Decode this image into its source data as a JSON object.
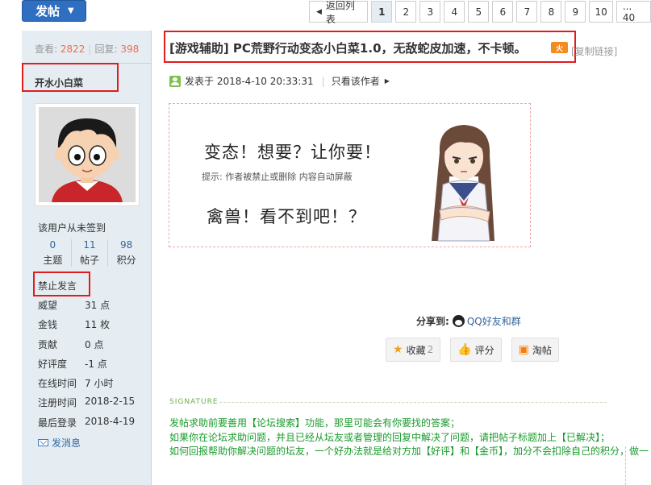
{
  "toolbar": {
    "post_button": "发帖",
    "post_caret": "▼"
  },
  "pager": {
    "back": "返回列表",
    "current": "1",
    "pages": [
      "2",
      "3",
      "4",
      "5",
      "6",
      "7",
      "8",
      "9",
      "10"
    ],
    "last": "... 40"
  },
  "thread": {
    "views_label": "查看:",
    "views": "2822",
    "replies_label": "回复:",
    "replies": "398",
    "title": "[游戏辅助] PC荒野行动变态小白菜1.0，无敌蛇皮加速，不卡顿。",
    "hot_badge": "火",
    "copy_link": "[复制链接]"
  },
  "author": {
    "name": "开水小白菜",
    "sign_status": "该用户从未签到",
    "counts": [
      {
        "value": "0",
        "label": "主题"
      },
      {
        "value": "11",
        "label": "帖子"
      },
      {
        "value": "98",
        "label": "积分"
      }
    ],
    "group": "禁止发言",
    "attributes": [
      {
        "key": "威望",
        "value": "31 点"
      },
      {
        "key": "金钱",
        "value": "11 枚"
      },
      {
        "key": "贡献",
        "value": "0 点"
      },
      {
        "key": "好评度",
        "value": "-1 点"
      },
      {
        "key": "在线时间",
        "value": "7 小时"
      },
      {
        "key": "注册时间",
        "value": "2018-2-15"
      },
      {
        "key": "最后登录",
        "value": "2018-4-19"
      }
    ],
    "send_message": "发消息"
  },
  "post": {
    "posted_at": "发表于 2018-4-10 20:33:31",
    "only_author": "只看该作者",
    "locked_line1": "变态！想要？让你要！",
    "locked_tip": "提示: 作者被禁止或删除 内容自动屏蔽",
    "locked_line2": "禽兽！看不到吧！？"
  },
  "share": {
    "label": "分享到:",
    "qq": "QQ好友和群"
  },
  "actions": [
    {
      "label": "收藏",
      "count": "2",
      "icon": "star-icon"
    },
    {
      "label": "评分",
      "count": "",
      "icon": "thumb-icon"
    },
    {
      "label": "淘帖",
      "count": "",
      "icon": "tao-icon"
    }
  ],
  "signature": {
    "label": "SIGNATURE",
    "line1_a": "发帖求助前要善用【论坛搜索】功能，那里可能会有你要找的答案；",
    "line2_a": "如果你在论坛求助问题，并且已经从坛友或者管理的回复中解决了问题，请把帖子标题加上【已解决】；",
    "line3_a": "如何回报帮助你解决问题的坛友，一个好办法就是给对方加【好评】和【金币】，加分不会扣除自己的积分，做一"
  },
  "colors": {
    "accent": "#2f6fc1",
    "sidebar_bg": "#e5edf2",
    "annotation": "#e01d1d",
    "signature": "#1a9b2c"
  }
}
